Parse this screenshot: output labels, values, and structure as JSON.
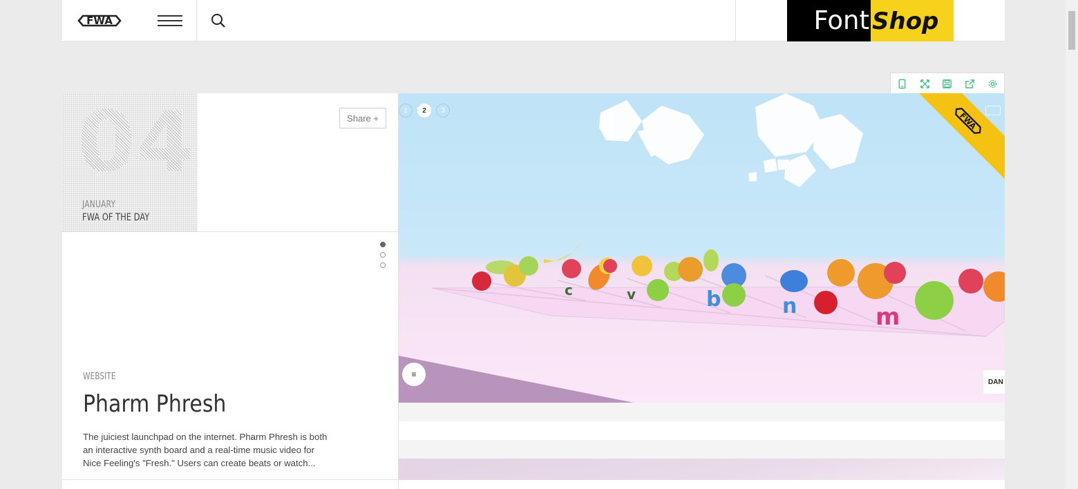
{
  "header": {
    "logo_text": "FWA",
    "sponsor": {
      "part1": "Font",
      "part2": "Shop"
    }
  },
  "toolbar": {
    "tools": [
      "mobile-icon",
      "fullscreen-icon",
      "save-icon",
      "external-link-icon",
      "settings-icon"
    ],
    "accent": "#2bb673"
  },
  "award": {
    "day": "04",
    "month": "JANUARY",
    "label": "FWA OF THE DAY"
  },
  "share": {
    "label": "Share +"
  },
  "project": {
    "type": "WEBSITE",
    "title": "Pharm Phresh",
    "description": "The juiciest launchpad on the internet. Pharm Phresh is both an interactive synth board and a real-time music video for Nice Feeling's \"Fresh.\" Users can create beats or watch..."
  },
  "preview": {
    "pages": [
      "1",
      "2",
      "3"
    ],
    "active_page": "2",
    "menu_glyph": "≡",
    "corner_button": "DAN"
  },
  "colors": {
    "ribbon": "#f4c212",
    "sky": "#bfe3f7",
    "floor": "#fbe7f8",
    "background": "#ebebeb"
  }
}
